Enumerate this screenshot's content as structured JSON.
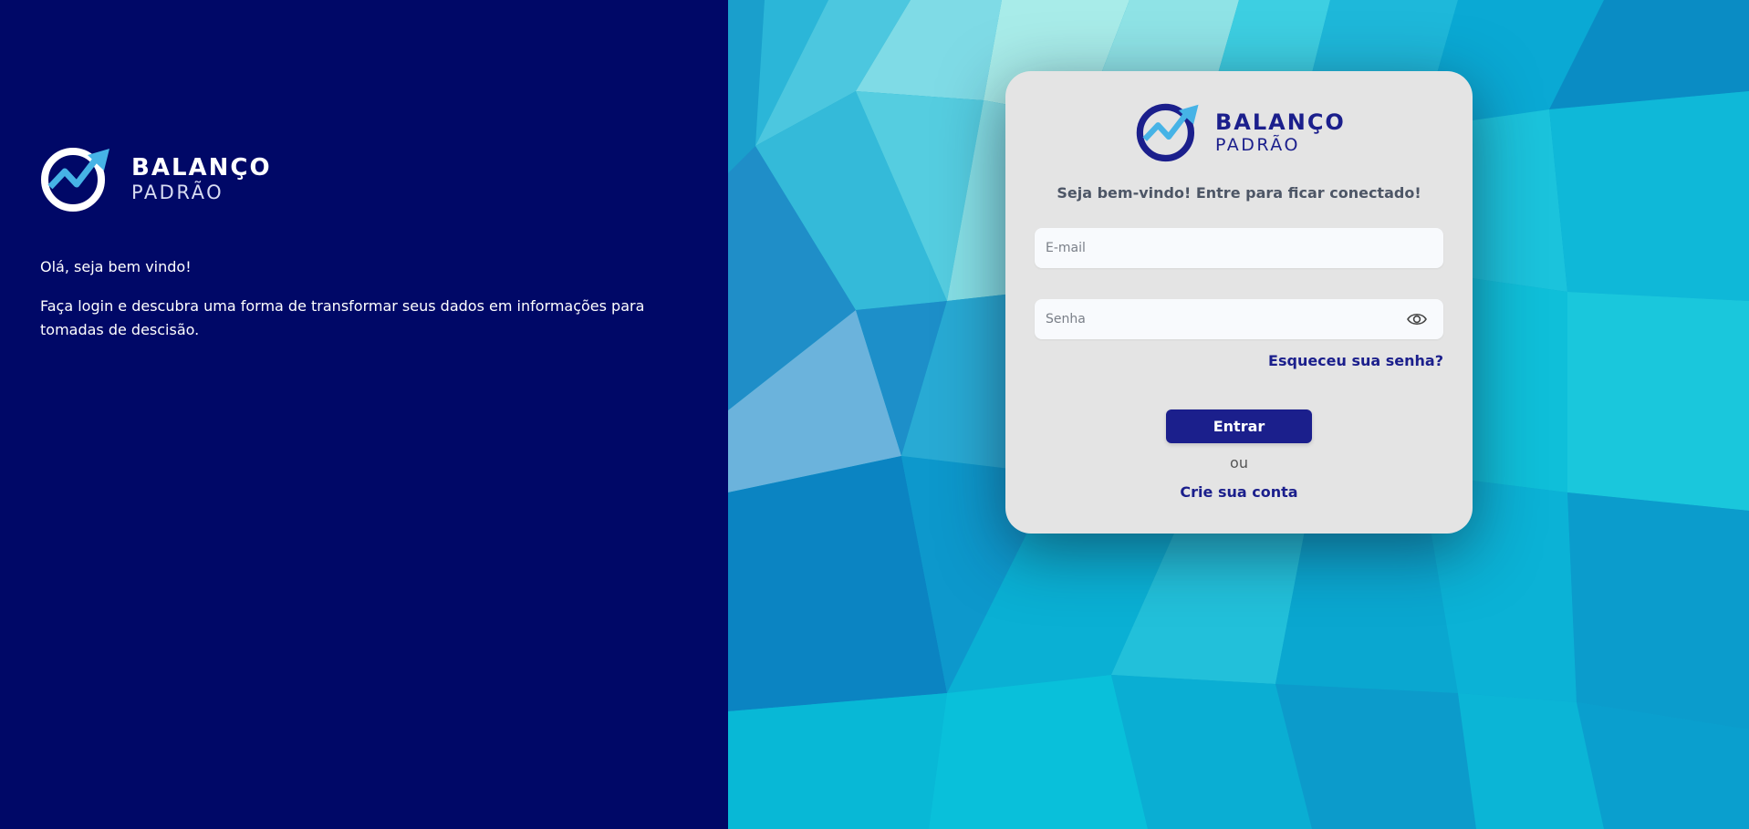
{
  "brand": {
    "line1": "BALANÇO",
    "line2": "PADRÃO"
  },
  "left_panel": {
    "greeting": "Olá, seja bem vindo!",
    "description": "Faça login e descubra uma forma de transformar seus dados em informações para tomadas de descisão."
  },
  "login_card": {
    "welcome": "Seja bem-vindo! Entre para ficar conectado!",
    "email_placeholder": "E-mail",
    "email_value": "",
    "password_placeholder": "Senha",
    "password_value": "",
    "forgot_link": "Esqueceu sua senha?",
    "submit_label": "Entrar",
    "or_text": "ou",
    "create_account_link": "Crie sua conta"
  },
  "icons": {
    "logo": "logo-check-arrow-icon",
    "password_toggle": "eye-icon"
  },
  "colors": {
    "left_background": "#000867",
    "accent": "#1b1f8c",
    "card_background": "#e4e4e4",
    "logo_arrow": "#46b3e6"
  }
}
